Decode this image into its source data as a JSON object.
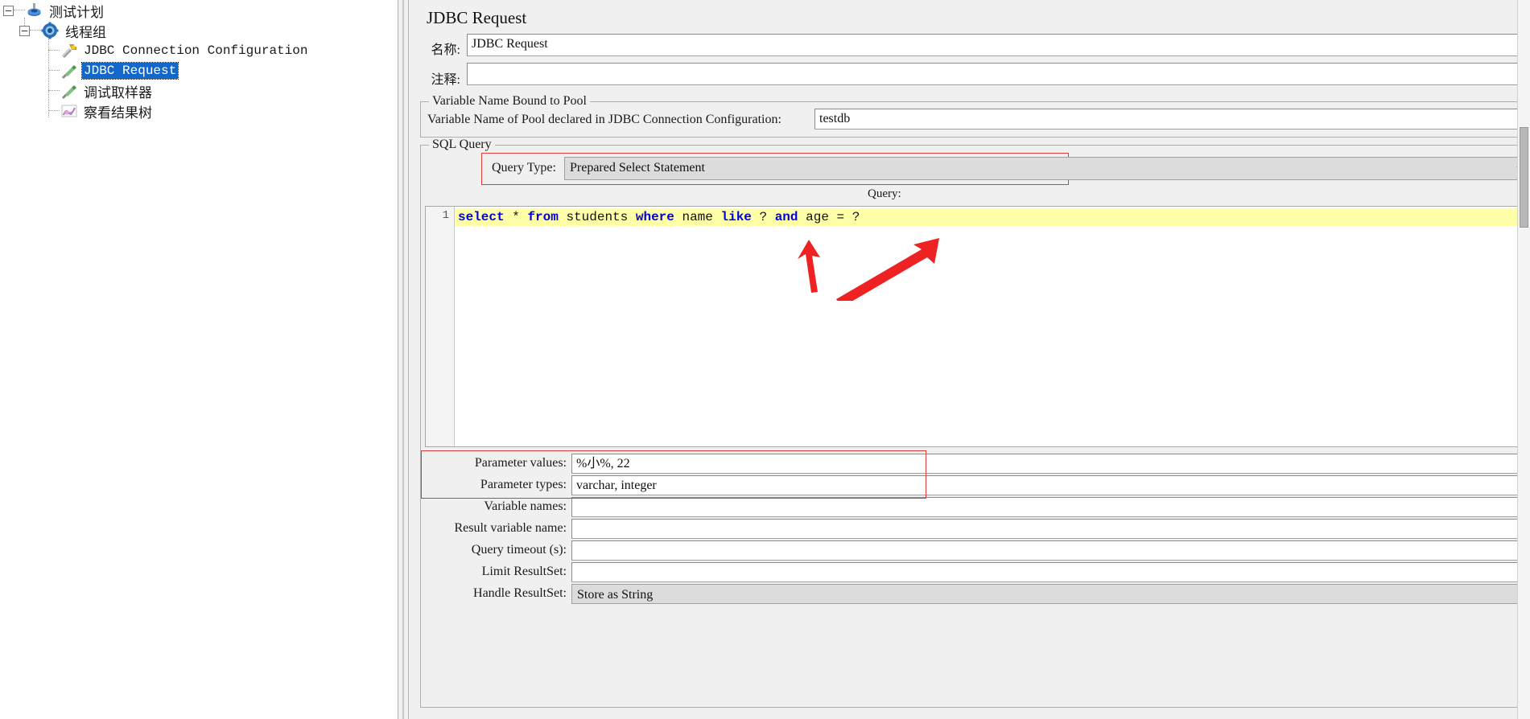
{
  "tree": {
    "items": [
      {
        "label": "测试计划",
        "icon": "test-plan-icon",
        "depth": 0,
        "selected": false
      },
      {
        "label": "线程组",
        "icon": "thread-group-icon",
        "depth": 1,
        "selected": false
      },
      {
        "label": "JDBC Connection Configuration",
        "icon": "config-element-icon",
        "depth": 2,
        "selected": false
      },
      {
        "label": "JDBC Request",
        "icon": "sampler-icon",
        "depth": 2,
        "selected": true
      },
      {
        "label": "调试取样器",
        "icon": "sampler-icon",
        "depth": 2,
        "selected": false
      },
      {
        "label": "察看结果树",
        "icon": "listener-icon",
        "depth": 2,
        "selected": false
      }
    ]
  },
  "main": {
    "title": "JDBC Request",
    "name": {
      "label": "名称:",
      "value": "JDBC Request"
    },
    "comment": {
      "label": "注释:",
      "value": ""
    },
    "pool_group": {
      "legend": "Variable Name Bound to Pool",
      "label": "Variable Name of Pool declared in JDBC Connection Configuration:",
      "value": "testdb"
    },
    "sql_group": {
      "legend": "SQL Query",
      "query_type": {
        "label": "Query Type:",
        "value": "Prepared Select Statement"
      },
      "query_caption": "Query:",
      "editor": {
        "line_number": "1",
        "tokens": [
          {
            "t": "select",
            "k": true
          },
          {
            "t": " ",
            "k": false
          },
          {
            "t": "*",
            "k": false
          },
          {
            "t": " ",
            "k": false
          },
          {
            "t": "from",
            "k": true
          },
          {
            "t": " students ",
            "k": false
          },
          {
            "t": "where",
            "k": true
          },
          {
            "t": " name ",
            "k": false
          },
          {
            "t": "like",
            "k": true
          },
          {
            "t": " ? ",
            "k": false
          },
          {
            "t": "and",
            "k": true
          },
          {
            "t": " age = ?",
            "k": false
          }
        ],
        "plain": "select * from students where name like ? and age = ?"
      },
      "fields": [
        {
          "label": "Parameter values:",
          "value": "%小%, 22",
          "type": "text",
          "highlight": true
        },
        {
          "label": "Parameter types:",
          "value": "varchar, integer",
          "type": "text",
          "highlight": true
        },
        {
          "label": "Variable names:",
          "value": "",
          "type": "text",
          "highlight": false
        },
        {
          "label": "Result variable name:",
          "value": "",
          "type": "text",
          "highlight": false
        },
        {
          "label": "Query timeout (s):",
          "value": "",
          "type": "text",
          "highlight": false
        },
        {
          "label": "Limit ResultSet:",
          "value": "",
          "type": "text",
          "highlight": false
        },
        {
          "label": "Handle ResultSet:",
          "value": "Store as String",
          "type": "combo",
          "highlight": false
        }
      ]
    }
  },
  "annotations": {
    "accent_color": "#e03b3b",
    "arrows": 2,
    "boxes": 2
  }
}
